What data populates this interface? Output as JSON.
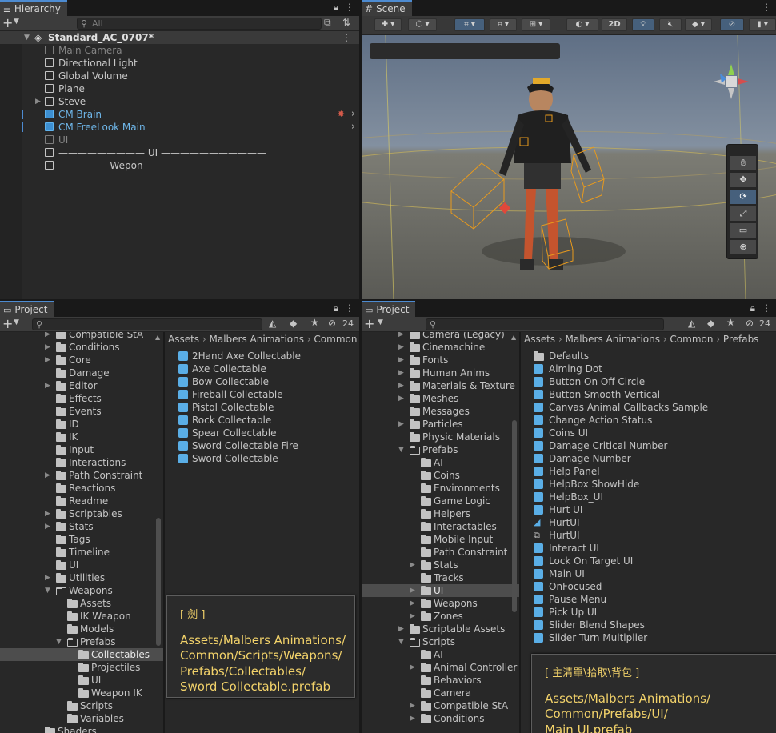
{
  "hierarchy": {
    "tab": "Hierarchy",
    "search_placeholder": "All",
    "scene": "Standard_AC_0707*",
    "items": [
      {
        "label": "Main Camera",
        "style": "dim"
      },
      {
        "label": "Directional Light",
        "style": "normal"
      },
      {
        "label": "Global Volume",
        "style": "normal"
      },
      {
        "label": "Plane",
        "style": "normal"
      },
      {
        "label": "Steve",
        "style": "normal"
      },
      {
        "label": "CM Brain",
        "style": "blue"
      },
      {
        "label": "CM FreeLook Main",
        "style": "blue"
      },
      {
        "label": "UI",
        "style": "dim"
      },
      {
        "label": "————————— UI ———————————",
        "style": "normal"
      },
      {
        "label": "-------------- Wepon---------------------",
        "style": "normal"
      }
    ]
  },
  "scene": {
    "tab": "Scene",
    "mode_2d": "2D"
  },
  "project_left": {
    "tab": "Project",
    "hidden_count": "24",
    "breadcrumb": [
      "Assets",
      "Malbers Animations",
      "Common"
    ],
    "tree": [
      {
        "label": "Compatible StA",
        "indent": 0,
        "arrow": true
      },
      {
        "label": "Conditions",
        "indent": 0,
        "arrow": true
      },
      {
        "label": "Core",
        "indent": 0,
        "arrow": true
      },
      {
        "label": "Damage",
        "indent": 0,
        "arrow": false
      },
      {
        "label": "Editor",
        "indent": 0,
        "arrow": true
      },
      {
        "label": "Effects",
        "indent": 0,
        "arrow": false
      },
      {
        "label": "Events",
        "indent": 0,
        "arrow": false
      },
      {
        "label": "ID",
        "indent": 0,
        "arrow": false
      },
      {
        "label": "IK",
        "indent": 0,
        "arrow": false
      },
      {
        "label": "Input",
        "indent": 0,
        "arrow": false
      },
      {
        "label": "Interactions",
        "indent": 0,
        "arrow": false
      },
      {
        "label": "Path Constraint",
        "indent": 0,
        "arrow": true
      },
      {
        "label": "Reactions",
        "indent": 0,
        "arrow": false
      },
      {
        "label": "Readme",
        "indent": 0,
        "arrow": false
      },
      {
        "label": "Scriptables",
        "indent": 0,
        "arrow": true
      },
      {
        "label": "Stats",
        "indent": 0,
        "arrow": true
      },
      {
        "label": "Tags",
        "indent": 0,
        "arrow": false
      },
      {
        "label": "Timeline",
        "indent": 0,
        "arrow": false
      },
      {
        "label": "UI",
        "indent": 0,
        "arrow": false
      },
      {
        "label": "Utilities",
        "indent": 0,
        "arrow": true
      },
      {
        "label": "Weapons",
        "indent": 0,
        "arrow": "open"
      },
      {
        "label": "Assets",
        "indent": 1,
        "arrow": false
      },
      {
        "label": "IK Weapon",
        "indent": 1,
        "arrow": false
      },
      {
        "label": "Models",
        "indent": 1,
        "arrow": false
      },
      {
        "label": "Prefabs",
        "indent": 1,
        "arrow": "open"
      },
      {
        "label": "Collectables",
        "indent": 2,
        "arrow": false,
        "selected": true
      },
      {
        "label": "Projectiles",
        "indent": 2,
        "arrow": false
      },
      {
        "label": "UI",
        "indent": 2,
        "arrow": false
      },
      {
        "label": "Weapon IK",
        "indent": 2,
        "arrow": false
      },
      {
        "label": "Scripts",
        "indent": 1,
        "arrow": false
      },
      {
        "label": "Variables",
        "indent": 1,
        "arrow": false
      },
      {
        "label": "Shaders",
        "indent": -1,
        "arrow": false
      }
    ],
    "files": [
      "2Hand Axe Collectable",
      "Axe Collectable",
      "Bow Collectable",
      "Fireball Collectable",
      "Pistol Collectable",
      "Rock Collectable",
      "Spear Collectable",
      "Sword Collectable Fire",
      "Sword Collectable"
    ],
    "note_header": "[ 劍 ]",
    "note_lines": [
      "Assets/Malbers Animations/",
      "Common/Scripts/Weapons/",
      "Prefabs/Collectables/",
      "Sword Collectable.prefab"
    ]
  },
  "project_right": {
    "tab": "Project",
    "hidden_count": "24",
    "breadcrumb": [
      "Assets",
      "Malbers Animations",
      "Common",
      "Prefabs"
    ],
    "tree": [
      {
        "label": "Camera (Legacy)",
        "indent": 0,
        "arrow": true
      },
      {
        "label": "Cinemachine",
        "indent": 0,
        "arrow": true
      },
      {
        "label": "Fonts",
        "indent": 0,
        "arrow": true
      },
      {
        "label": "Human Anims",
        "indent": 0,
        "arrow": true
      },
      {
        "label": "Materials & Texture",
        "indent": 0,
        "arrow": true
      },
      {
        "label": "Meshes",
        "indent": 0,
        "arrow": true
      },
      {
        "label": "Messages",
        "indent": 0,
        "arrow": false
      },
      {
        "label": "Particles",
        "indent": 0,
        "arrow": true
      },
      {
        "label": "Physic Materials",
        "indent": 0,
        "arrow": false
      },
      {
        "label": "Prefabs",
        "indent": 0,
        "arrow": "open"
      },
      {
        "label": "AI",
        "indent": 1,
        "arrow": false
      },
      {
        "label": "Coins",
        "indent": 1,
        "arrow": false
      },
      {
        "label": "Environments",
        "indent": 1,
        "arrow": false
      },
      {
        "label": "Game Logic",
        "indent": 1,
        "arrow": false
      },
      {
        "label": "Helpers",
        "indent": 1,
        "arrow": false
      },
      {
        "label": "Interactables",
        "indent": 1,
        "arrow": false
      },
      {
        "label": "Mobile Input",
        "indent": 1,
        "arrow": false
      },
      {
        "label": "Path Constraint",
        "indent": 1,
        "arrow": false
      },
      {
        "label": "Stats",
        "indent": 1,
        "arrow": true
      },
      {
        "label": "Tracks",
        "indent": 1,
        "arrow": false
      },
      {
        "label": "UI",
        "indent": 1,
        "arrow": true,
        "selected": true
      },
      {
        "label": "Weapons",
        "indent": 1,
        "arrow": true
      },
      {
        "label": "Zones",
        "indent": 1,
        "arrow": true
      },
      {
        "label": "Scriptable Assets",
        "indent": 0,
        "arrow": true
      },
      {
        "label": "Scripts",
        "indent": 0,
        "arrow": "open"
      },
      {
        "label": "AI",
        "indent": 1,
        "arrow": false
      },
      {
        "label": "Animal Controller",
        "indent": 1,
        "arrow": true
      },
      {
        "label": "Behaviors",
        "indent": 1,
        "arrow": false
      },
      {
        "label": "Camera",
        "indent": 1,
        "arrow": false
      },
      {
        "label": "Compatible StA",
        "indent": 1,
        "arrow": true
      },
      {
        "label": "Conditions",
        "indent": 1,
        "arrow": true
      }
    ],
    "files": [
      {
        "label": "Defaults",
        "kind": "folder"
      },
      {
        "label": "Aiming Dot",
        "kind": "prefab"
      },
      {
        "label": "Button On Off Circle",
        "kind": "prefab"
      },
      {
        "label": "Button Smooth Vertical",
        "kind": "prefab"
      },
      {
        "label": "Canvas Animal Callbacks Sample",
        "kind": "prefab"
      },
      {
        "label": "Change Action Status",
        "kind": "prefab"
      },
      {
        "label": "Coins UI",
        "kind": "prefab"
      },
      {
        "label": "Damage Critical Number",
        "kind": "prefab"
      },
      {
        "label": "Damage Number",
        "kind": "prefab"
      },
      {
        "label": "Help Panel",
        "kind": "prefab"
      },
      {
        "label": "HelpBox ShowHide",
        "kind": "prefab"
      },
      {
        "label": "HelpBox_UI",
        "kind": "prefab"
      },
      {
        "label": "Hurt UI",
        "kind": "prefab"
      },
      {
        "label": "HurtUI",
        "kind": "anim"
      },
      {
        "label": "HurtUI",
        "kind": "controller"
      },
      {
        "label": "Interact UI",
        "kind": "prefab"
      },
      {
        "label": "Lock On Target UI",
        "kind": "prefab"
      },
      {
        "label": "Main UI",
        "kind": "prefab"
      },
      {
        "label": "OnFocused",
        "kind": "prefab"
      },
      {
        "label": "Pause Menu",
        "kind": "prefab"
      },
      {
        "label": "Pick Up UI",
        "kind": "prefab"
      },
      {
        "label": "Slider Blend Shapes",
        "kind": "prefab"
      },
      {
        "label": "Slider Turn Multiplier",
        "kind": "prefab"
      }
    ],
    "note_header": "[ 主清單\\拾取\\背包 ]",
    "note_lines": [
      "Assets/Malbers Animations/",
      "Common/Prefabs/UI/",
      "Main UI.prefab"
    ]
  }
}
